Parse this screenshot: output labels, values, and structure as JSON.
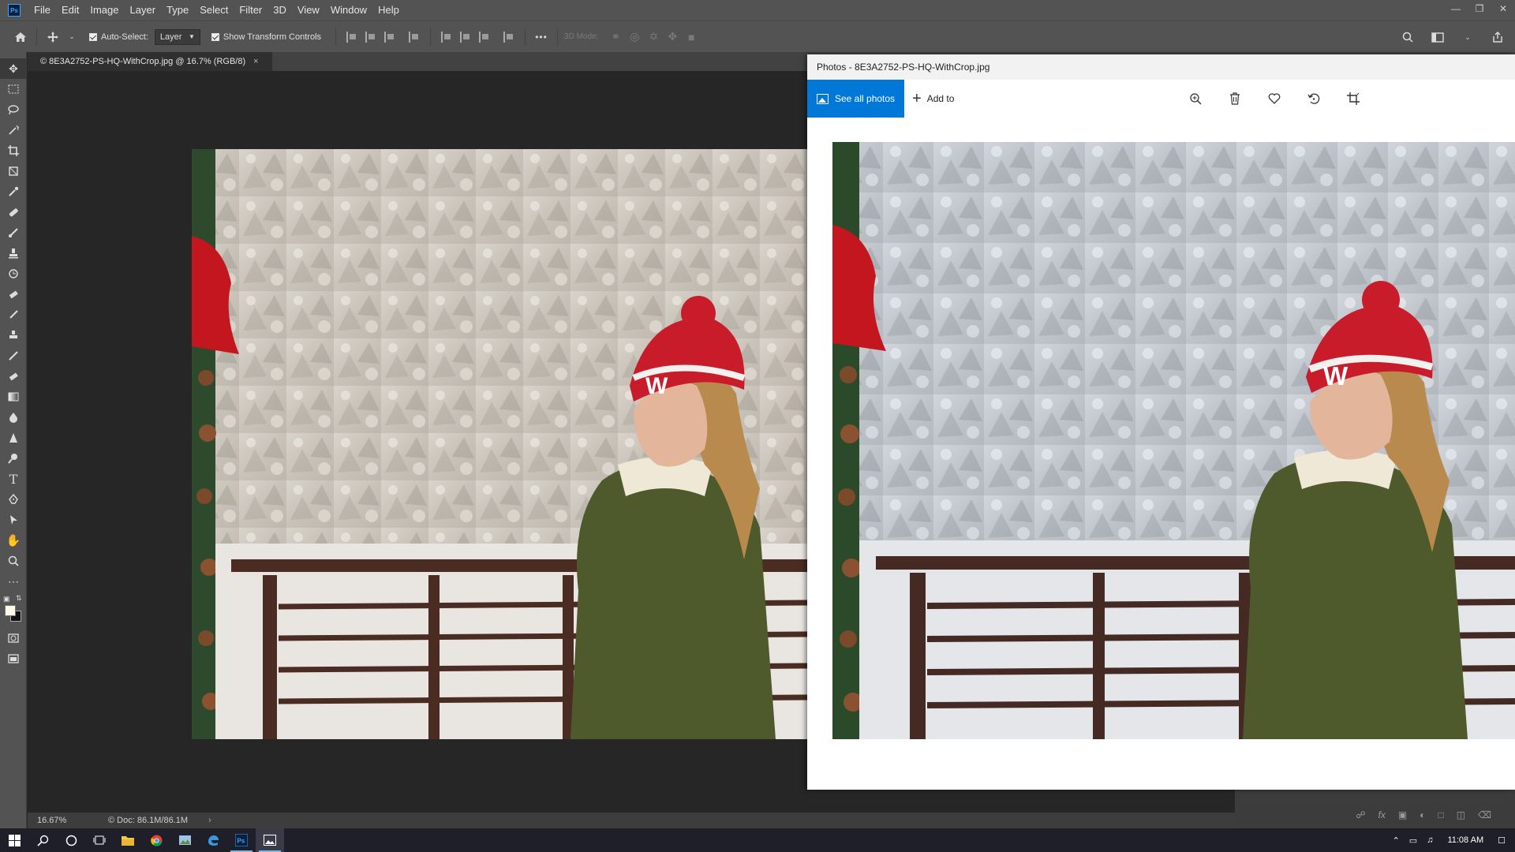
{
  "menubar": {
    "logo": "Ps",
    "items": [
      "File",
      "Edit",
      "Image",
      "Layer",
      "Type",
      "Select",
      "Filter",
      "3D",
      "View",
      "Window",
      "Help"
    ]
  },
  "options": {
    "auto_select_label": "Auto-Select:",
    "layer_value": "Layer",
    "show_transform_label": "Show Transform Controls",
    "more": "•••",
    "mode_3d": "3D Mode:"
  },
  "document": {
    "tab_label": "© 8E3A2752-PS-HQ-WithCrop.jpg @ 16.7% (RGB/8)",
    "tab_close": "×",
    "zoom": "16.67%",
    "doc_size": "© Doc: 86.1M/86.1M",
    "status_arrow": "›"
  },
  "photos": {
    "title": "Photos - 8E3A2752-PS-HQ-WithCrop.jpg",
    "see_all": "See all photos",
    "add_to": "Add to"
  },
  "taskbar": {
    "time": "11:08 AM"
  },
  "colors": {
    "accent": "#0078d7",
    "ps_bg": "#535353",
    "canvas_bg": "#282828"
  }
}
